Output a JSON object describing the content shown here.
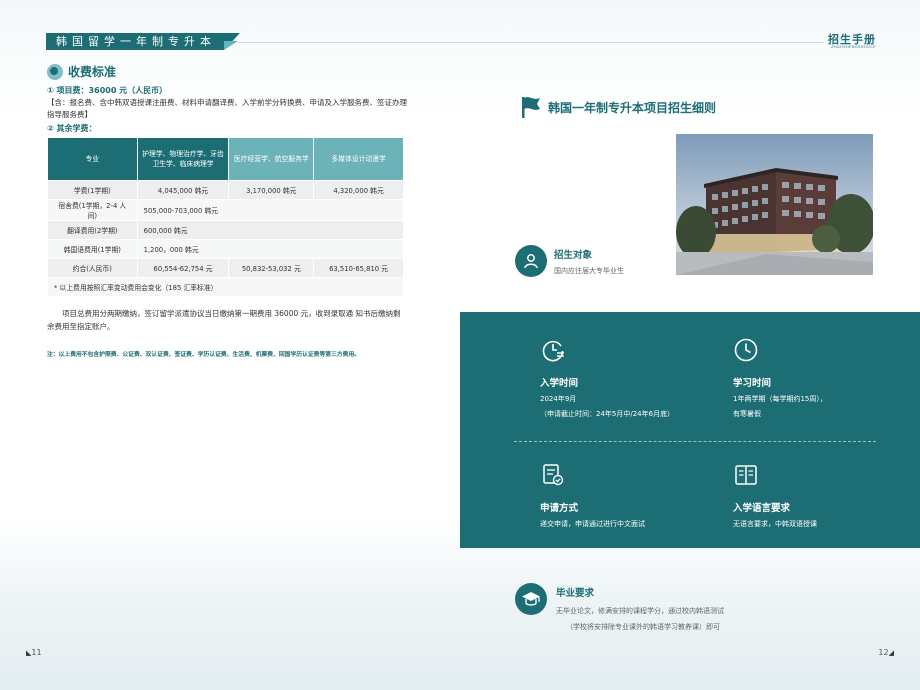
{
  "header": {
    "banner": "韩国留学一年制专升本",
    "brand": "招生手册",
    "brand_sub": "ZHAOSHENGSHOUCE"
  },
  "left": {
    "section_title": "收费标准",
    "fee_main": "① 项目费：36000 元（人民币）",
    "fee_desc": "【含：报名费、含中韩双语授课注册费、材料申请翻译费、入学前学分转换费、申请及入学服务费、签证办理指导服务费】",
    "fee_other": "② 其余学费：",
    "table": {
      "headers": [
        "专业",
        "护理学、物理治疗学、牙齿卫生学、临床病理学",
        "医疗经营学、航空服务学",
        "多媒体设计动漫学"
      ],
      "rows": [
        [
          "学费(1学期)",
          "4,045,000 韩元",
          "3,170,000 韩元",
          "4,320,000 韩元"
        ],
        [
          "宿舍费(1学期，2-4 人间)",
          "505,000-703,000 韩元"
        ],
        [
          "翻译费用(2学期)",
          "600,000 韩元"
        ],
        [
          "韩国语费用(1学期)",
          "1,200，000 韩元"
        ],
        [
          "约合(人民币)",
          "60,554-62,754 元",
          "50,832-53,032 元",
          "63,510-65,810 元"
        ],
        [
          "* 以上费用按照汇率变动费用会变化（185 汇率标准）"
        ]
      ]
    },
    "paragraph": "项目总费用分两期缴纳，签订留学派遣协议当日缴纳第一期费用 36000 元，收到录取通 知书后缴纳剩余费用至指定账户。",
    "footnote": "注：以上费用不包含护照费、公证费、双认证费、签证费、学历认证费、生活费、机票费、回国学历认证费等第三方费用。",
    "page_number": "11"
  },
  "right": {
    "title": "韩国一年制专升本项目招生细则",
    "target_head": "招生对象",
    "target_sub": "国内应往届大专毕业生",
    "cells": {
      "enroll_head": "入学时间",
      "enroll_line1": "2024年9月",
      "enroll_line2": "（申请截止时间：24年5月中/24年6月底）",
      "study_head": "学习时间",
      "study_line1": "1年两学期（每学期约15周），",
      "study_line2": "有寒暑假",
      "apply_head": "申请方式",
      "apply_line1": "递交申请，申请通过进行中文面试",
      "lang_head": "入学语言要求",
      "lang_line1": "无语言要求，中韩双语授课"
    },
    "grad_head": "毕业要求",
    "grad_line1": "无毕业论文，修满安排的课程学分，通过校内韩语测试",
    "grad_line2": "（学校将安排除专业课外的韩语学习教养课）即可",
    "page_number": "12"
  },
  "colors": {
    "teal": "#1d6d75",
    "light_teal": "#6bb2b9"
  }
}
